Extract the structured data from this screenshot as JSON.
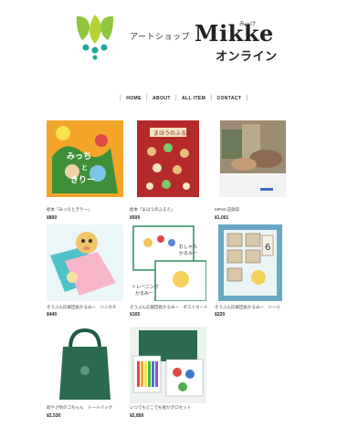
{
  "header": {
    "logo_icon": "mikke-logo-icon",
    "prefix": "アートショップ",
    "name": "Mikke",
    "ruby": "みっけ",
    "online": "オンライン"
  },
  "nav": {
    "items": [
      "HOME",
      "ABOUT",
      "ALL ITEM",
      "CONTACT"
    ]
  },
  "products": [
    {
      "name": "絵本「みっちときりー」",
      "price": "¥800",
      "icon": "picture-book-cover-michi-kiri"
    },
    {
      "name": "絵本「まほうのふるえ」",
      "price": "¥509",
      "icon": "picture-book-cover-mahou"
    },
    {
      "name": "MPAD 記録誌",
      "price": "¥1,001",
      "icon": "magazine-photo"
    },
    {
      "name": "そうぶん応援団長かるみー　ハンカチ",
      "price": "¥440",
      "icon": "handkerchief"
    },
    {
      "name": "そうぶん応援団長かるみー　ポストカード",
      "price": "¥165",
      "icon": "postcard"
    },
    {
      "name": "そうぶん応援団長かるみー　シール",
      "price": "¥220",
      "icon": "sticker-sheet"
    },
    {
      "name": "岐やさ吹のコちゃん　トートバッグ",
      "price": "¥2,530",
      "icon": "tote-bag"
    },
    {
      "name": "いつでもどこでも絵かき口セット",
      "price": "¥2,850",
      "icon": "drawing-set"
    }
  ],
  "colors": {
    "logo_green": "#8dc63f",
    "logo_teal": "#1aa89a",
    "text_dark": "#222222"
  }
}
